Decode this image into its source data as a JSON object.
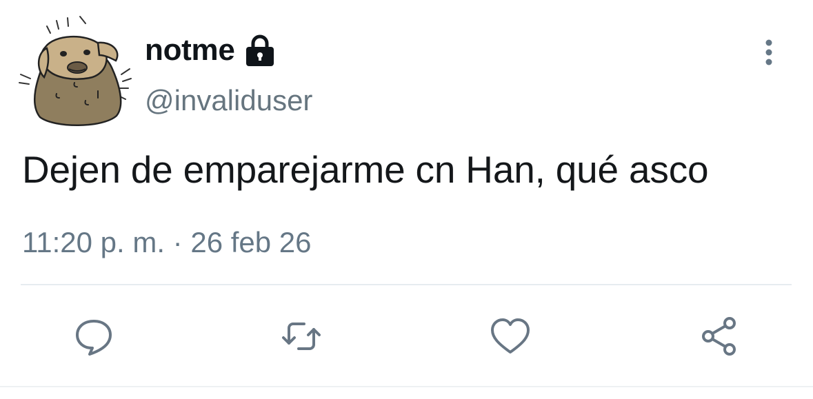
{
  "user": {
    "display_name": "notme",
    "handle": "@invaliduser",
    "avatar": "dog-avatar",
    "protected_icon": "lock-icon"
  },
  "tweet": {
    "text": "Dejen de emparejarme cn Han, qué asco",
    "timestamp": "11:20 p. m. · 26 feb 26"
  },
  "actions": [
    {
      "name": "reply",
      "icon": "comment-icon"
    },
    {
      "name": "retweet",
      "icon": "retweet-icon"
    },
    {
      "name": "like",
      "icon": "heart-icon"
    },
    {
      "name": "share",
      "icon": "share-icon"
    }
  ],
  "menu_icon": "more-vertical-icon",
  "colors": {
    "text": "#14171a",
    "secondary": "#657786",
    "icon": "#687684",
    "divider": "#e6ecf0",
    "avatar_fill": "#8f7e5e"
  }
}
